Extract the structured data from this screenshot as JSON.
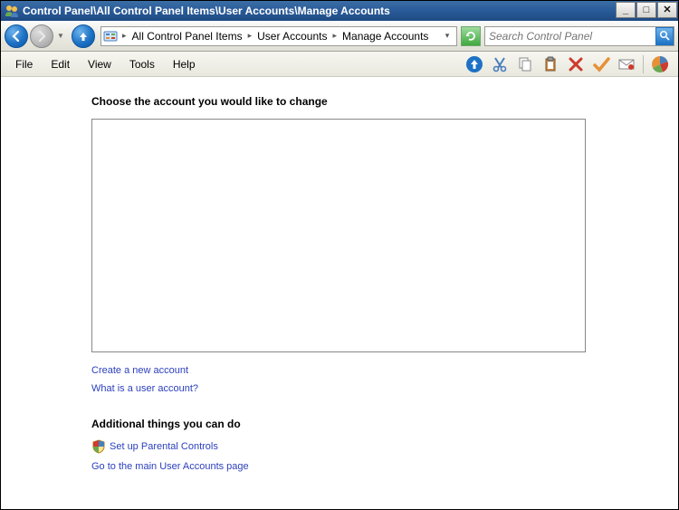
{
  "titlebar": {
    "title": "Control Panel\\All Control Panel Items\\User Accounts\\Manage Accounts"
  },
  "breadcrumb": {
    "items": [
      "All Control Panel Items",
      "User Accounts",
      "Manage Accounts"
    ]
  },
  "search": {
    "placeholder": "Search Control Panel"
  },
  "menu": {
    "file": "File",
    "edit": "Edit",
    "view": "View",
    "tools": "Tools",
    "help": "Help"
  },
  "content": {
    "heading": "Choose the account you would like to change",
    "link_create": "Create a new account",
    "link_what_is": "What is a user account?",
    "section_head": "Additional things you can do",
    "link_parental": "Set up Parental Controls",
    "link_main": "Go to the main User Accounts page"
  }
}
